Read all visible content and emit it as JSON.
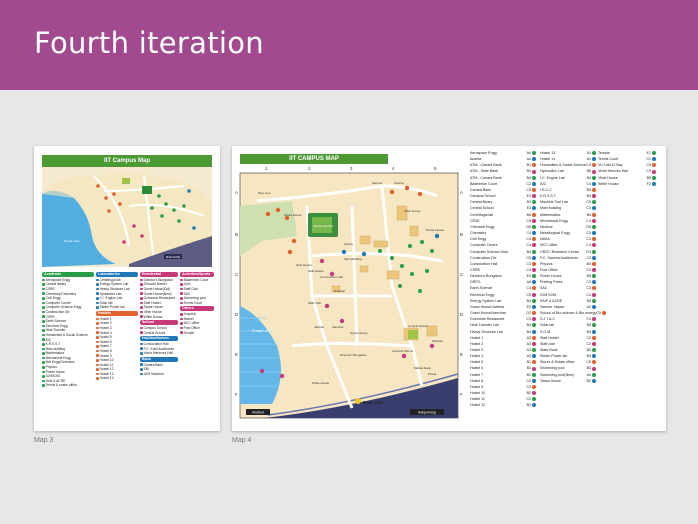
{
  "slide": {
    "title": "Fourth iteration"
  },
  "captions": {
    "map3": "Map 3",
    "map4": "Map 4"
  },
  "map3": {
    "title": "IIT Campus Map",
    "legend": [
      {
        "heading": "Academic",
        "color": "#2a9d48",
        "items": [
          "Aerospace Engg",
          "Central library",
          "CSRE",
          "Chemistry/Chemistry",
          "Civil Engg",
          "Computer Centre",
          "Computer Science Engg",
          "Construction Div",
          "CSRE",
          "Earth Science",
          "Electrical Engg",
          "Heat Transfer",
          "Humanities & Social Science",
          "IDC",
          "K.R.S.S.T",
          "Main building",
          "Mathematics",
          "Mechanical Engg",
          "Met Engg/Ceramics",
          "Physics",
          "Power house",
          "SJMSOM",
          "SoM & ACRE",
          "Tennis & snake office"
        ]
      },
      {
        "heading": "Laboratories",
        "color": "#1f79b8",
        "items": [
          "Centrifugal lab",
          "Energy System Lab",
          "Heavy Structure Lab",
          "Hydraulics Lab",
          "I.C. Engine Lab",
          "Solar lab",
          "Steam Power lab"
        ]
      },
      {
        "heading": "Hostels",
        "color": "#e0622b",
        "items": [
          "Hostel 1",
          "Hostel 2",
          "Hostel 3",
          "Hostel 4",
          "Hostel 5",
          "Hostel 6",
          "Hostel 7",
          "Hostel 8",
          "Hostel 9",
          "Hostel 10",
          "Hostel 11",
          "Hostel 12",
          "Hostel 13",
          "Hostel 14"
        ]
      },
      {
        "heading": "Residential",
        "color": "#c8397a",
        "items": [
          "Director's Bungalow",
          "Dhruvad Barrier",
          "Guest House(Old)",
          "Guest House(New)",
          "Gulmohar Restaurant",
          "Staff Hostel",
          "Tansa House",
          "Vihar House",
          "White House"
        ]
      },
      {
        "heading": "School",
        "color": "#c8397a",
        "items": [
          "Campus School",
          "Central School"
        ]
      },
      {
        "heading": "Hall/Auditorium",
        "color": "#1f79b8",
        "items": [
          "Convocation Hall",
          "F.C. Kohli Auditorium",
          "Victor Menezes Hall"
        ]
      },
      {
        "heading": "Bank",
        "color": "#1f79b8",
        "items": [
          "Canara Bank",
          "SBI",
          "ATM Machine"
        ]
      },
      {
        "heading": "Activities/Sports",
        "color": "#c8397a",
        "items": [
          "Badminton Court",
          "Gym",
          "Staff Club",
          "SAC",
          "Swimming pool",
          "Tennis Court"
        ]
      },
      {
        "heading": "Others",
        "color": "#c8397a",
        "items": [
          "Hospital",
          "Market",
          "NCC office",
          "Post Office",
          "Temple"
        ]
      }
    ],
    "labels": {
      "lake": "Powai Lake",
      "gate": "MAIN GATE",
      "gate2": "Lakeside gate"
    }
  },
  "map4": {
    "title": "IIT CAMPUS MAP",
    "columns": [
      "1",
      "2",
      "3",
      "4",
      "5"
    ],
    "rows": [
      "A",
      "B",
      "C",
      "D",
      "E",
      "F"
    ],
    "map_labels": {
      "lake": "Powai Lake",
      "pipeline": "Pipe Line",
      "sports": "Sports Ground",
      "main_gate": "Main Gate",
      "market_gate": "Market Gate",
      "andheri": "Andheri",
      "kanjurmarg": "Kanjurmarg",
      "library": "Library",
      "main_building": "Main Building",
      "convocation": "Convocation Hall",
      "hospital": "Hospital",
      "girls_hostel": "Girls Hostel",
      "staff_hostel": "Staff Hostel",
      "staff_club": "Staff Club",
      "vanvihar": "Vanvihar",
      "jalvihar": "Jalvihar",
      "guest_house": "Guest House",
      "campus_school": "Campus School",
      "central_school": "Central School",
      "white_house": "White House",
      "tansa": "Tansa House",
      "power_house": "Power House",
      "vihar_house": "Vihar House",
      "sameer": "Sameer",
      "ananta": "Ananta",
      "medical": "Medical",
      "powai": "Powai",
      "directors_bungalow": "Director's Bungalow"
    },
    "index_col1": [
      [
        "Aerospace Engg",
        "A4"
      ],
      [
        "Ananta",
        "A4"
      ],
      [
        "ATM - Canara Bank",
        "B1"
      ],
      [
        "ATM - State Bank",
        "B3"
      ],
      [
        "ATM - Canara Bank",
        "B4"
      ],
      [
        "Badminton Court",
        "C2"
      ],
      [
        "Canara Bank",
        "C3"
      ],
      [
        "Campus School",
        "E3"
      ],
      [
        "Central library",
        "B3"
      ],
      [
        "Central School",
        "E3"
      ],
      [
        "Centrifugal lab",
        "B4"
      ],
      [
        "CESE",
        "C5"
      ],
      [
        "Chemical Engg",
        "D5"
      ],
      [
        "Chemistry",
        "C4"
      ],
      [
        "Civil Engg",
        "C4"
      ],
      [
        "Computer Centre",
        "C4"
      ],
      [
        "Computer Science Dept",
        "B4"
      ],
      [
        "Construction Div",
        "C5"
      ],
      [
        "Convocation Hall",
        "C3"
      ],
      [
        "CSRE",
        "C4"
      ],
      [
        "Director's Bungalow",
        "E3"
      ],
      [
        "DRPO",
        "A4"
      ],
      [
        "Earth Science",
        "C4"
      ],
      [
        "Electrical Engg",
        "C5"
      ],
      [
        "Energy System Lab",
        "B4"
      ],
      [
        "Guest House/Jalvihar",
        "E2"
      ],
      [
        "Guest House/Vanvihar",
        "D2"
      ],
      [
        "Gulmohar Restaurant",
        "C3"
      ],
      [
        "Heat Transfer Lab",
        "B4"
      ],
      [
        "Heavy Structure Lab",
        "B4"
      ],
      [
        "Hostel 1",
        "A3"
      ],
      [
        "Hostel 2",
        "A3"
      ],
      [
        "Hostel 3",
        "A3"
      ],
      [
        "Hostel 4",
        "A3"
      ],
      [
        "Hostel 5",
        "B1"
      ],
      [
        "Hostel 6",
        "B1"
      ],
      [
        "Hostel 7",
        "B1"
      ],
      [
        "Hostel 8",
        "C2"
      ],
      [
        "Hostel 9",
        "C2"
      ],
      [
        "Hostel 10",
        "B2"
      ],
      [
        "Hostel 11",
        "C2"
      ],
      [
        "Hostel 12",
        "B1"
      ]
    ],
    "index_col2": [
      [
        "Hostel 13",
        "A1"
      ],
      [
        "Hostel 14",
        "A1"
      ],
      [
        "Humanities & Social Science",
        "C4"
      ],
      [
        "Hydraulics Lab",
        "B5"
      ],
      [
        "I.C. Engine Lab",
        "B4"
      ],
      [
        "IDC",
        "C4"
      ],
      [
        "I.R.C.C.",
        "B3"
      ],
      [
        "K.R.S.S.T",
        "B4"
      ],
      [
        "Machine Tool Lab",
        "C5"
      ],
      [
        "Main building",
        "C3"
      ],
      [
        "Mathematics",
        "B4"
      ],
      [
        "Mechanical Engg",
        "C4"
      ],
      [
        "Medical",
        "D5"
      ],
      [
        "Metallurgical Engg",
        "C5"
      ],
      [
        "NASA",
        "C3"
      ],
      [
        "NCC office",
        "C4"
      ],
      [
        "ORGC Research Centre",
        "D3"
      ],
      [
        "P.C. Saxena Auditorium",
        "C3"
      ],
      [
        "Physics",
        "B4"
      ],
      [
        "Post Office",
        "C3"
      ],
      [
        "Power House",
        "B5"
      ],
      [
        "Printing Press",
        "C3"
      ],
      [
        "SAC",
        "C3"
      ],
      [
        "SJM SOM",
        "C4"
      ],
      [
        "SAIF & ACRE",
        "B4"
      ],
      [
        "Sameer Inkpan",
        "A2"
      ],
      [
        "School of Bio-science & Bio-energy",
        "C5"
      ],
      [
        "S.J.T.A.C",
        "C4"
      ],
      [
        "Solar lab",
        "B4"
      ],
      [
        "S.O.M",
        "B4"
      ],
      [
        "Staff Hostel",
        "C2"
      ],
      [
        "Staff club",
        "C2"
      ],
      [
        "State Bank",
        "B3"
      ],
      [
        "Steam Power lab",
        "B4"
      ],
      [
        "Stores & Estate office",
        "C5"
      ],
      [
        "Swimming pool",
        "B3"
      ],
      [
        "Swimming pool(New)",
        "A4"
      ],
      [
        "Tansa House",
        "B2"
      ]
    ],
    "index_col3": [
      [
        "Temple",
        "E1"
      ],
      [
        "Tennis Court",
        "C2"
      ],
      [
        "VLI Lab/12 Bay",
        "C5"
      ],
      [
        "Victor Menzes Hall",
        "C3"
      ],
      [
        "Vihar House",
        "B5"
      ],
      [
        "White House",
        "F2"
      ]
    ]
  }
}
